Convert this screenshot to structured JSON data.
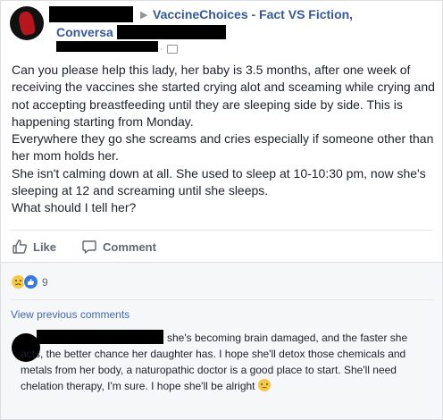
{
  "header": {
    "group_name_line1": "VaccineChoices - Fact VS Fiction,",
    "group_name_line2": "Conversa",
    "separator": "▶",
    "privacy_dot": "·"
  },
  "post": {
    "paragraphs": [
      "Can you please help this lady, her baby is 3.5 months, after one week of receiving the vaccines she started crying alot and sceaming while crying and not accepting breastfeeding until they are sleeping side by side. This is happening starting from Monday.",
      "Everywhere they go she screams and cries especially if someone other than her mom holds her.",
      "She isn't calming down at all. She used to sleep at 10-10:30 pm, now she's sleeping at 12 and screaming until she sleeps.",
      "What should I tell her?"
    ]
  },
  "actions": {
    "like_label": "Like",
    "comment_label": "Comment"
  },
  "reactions": {
    "count": "9",
    "types": [
      "sad-icon",
      "like-icon"
    ]
  },
  "comments": {
    "view_previous": "View previous comments",
    "items": [
      {
        "text": "she's becoming brain damaged, and the faster she acts, the better chance her daughter has. I hope she'll detox those chemicals and metals from her body, a naturopathic doctor is a good place to start. She'll need chelation therapy, I'm sure. I hope she'll be alright"
      }
    ]
  },
  "colors": {
    "link": "#365899",
    "text": "#1d2129",
    "muted": "#606770",
    "comment_link": "#4267b2"
  }
}
